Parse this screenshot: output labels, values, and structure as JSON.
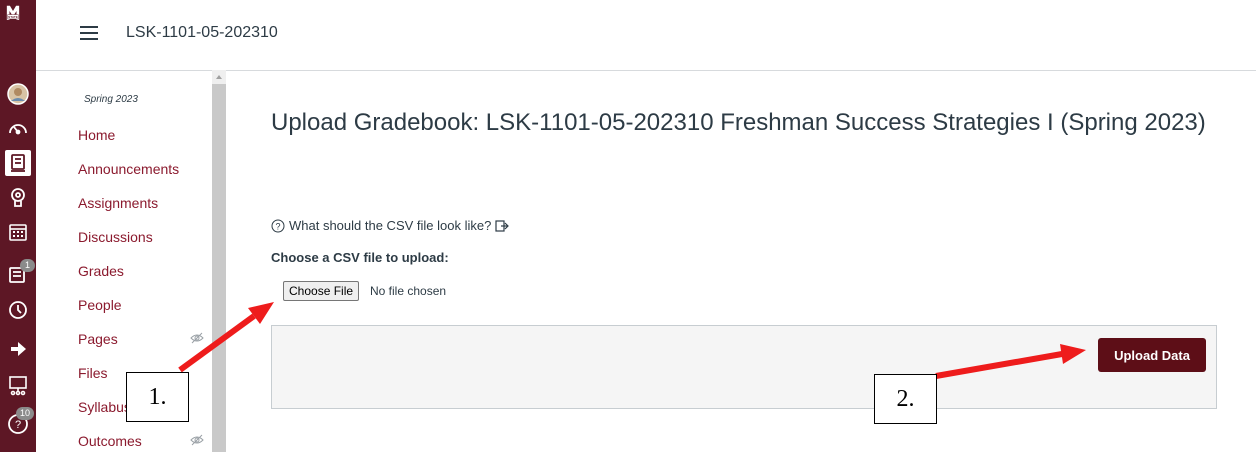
{
  "header": {
    "breadcrumb": "LSK-1101-05-202310"
  },
  "global_nav": {
    "logo_text": "STATE",
    "items": [
      {
        "icon": "avatar"
      },
      {
        "icon": "dashboard-icon"
      },
      {
        "icon": "courses-icon"
      },
      {
        "icon": "groups-icon"
      },
      {
        "icon": "calendar-icon"
      },
      {
        "icon": "inbox-icon",
        "badge": "1"
      },
      {
        "icon": "history-icon"
      },
      {
        "icon": "commons-icon"
      },
      {
        "icon": "studio-icon"
      },
      {
        "icon": "help-icon",
        "badge": "10"
      }
    ]
  },
  "course_nav": {
    "term": "Spring 2023",
    "items": [
      {
        "label": "Home"
      },
      {
        "label": "Announcements"
      },
      {
        "label": "Assignments"
      },
      {
        "label": "Discussions"
      },
      {
        "label": "Grades"
      },
      {
        "label": "People"
      },
      {
        "label": "Pages",
        "hidden": true
      },
      {
        "label": "Files"
      },
      {
        "label": "Syllabus"
      },
      {
        "label": "Outcomes",
        "hidden": true
      }
    ]
  },
  "main": {
    "title": "Upload Gradebook: LSK-1101-05-202310 Freshman Success Strategies I (Spring 2023)",
    "help_link": "What should the CSV file look like?",
    "choose_label": "Choose a CSV file to upload:",
    "file_button": "Choose File",
    "file_status": "No file chosen",
    "upload_button": "Upload Data"
  },
  "annotations": {
    "callout1": "1.",
    "callout2": "2.",
    "arrow_color": "#ee1c1c"
  },
  "colors": {
    "nav_bg": "#5d1725",
    "link": "#8b1a2e",
    "upload_btn": "#5d0e17"
  }
}
